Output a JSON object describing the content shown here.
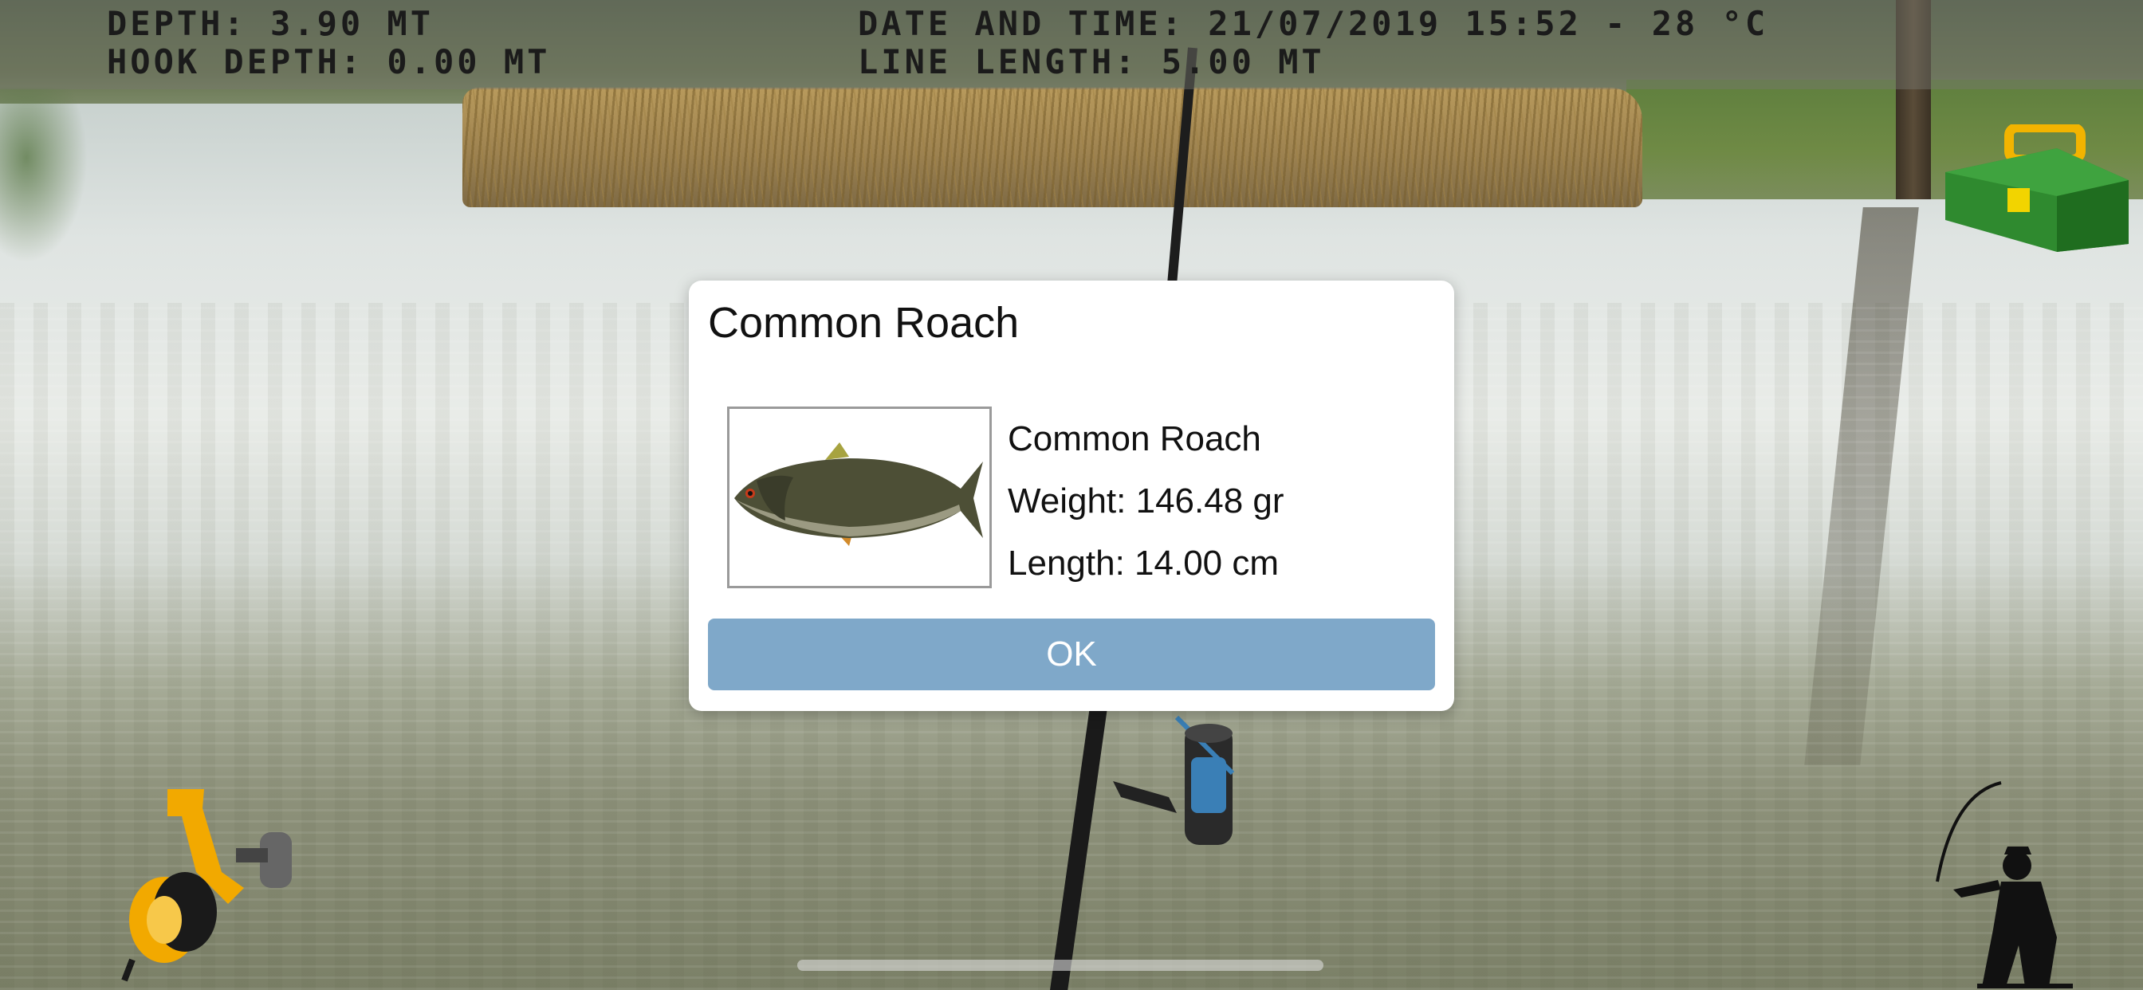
{
  "hud": {
    "depth": "DEPTH: 3.90 MT",
    "hook_depth": "HOOK DEPTH: 0.00 MT",
    "date_time": "DATE AND TIME: 21/07/2019 15:52 - 28 °C",
    "line_length": "LINE LENGTH: 5.00 MT"
  },
  "dialog": {
    "title": "Common Roach",
    "fish_name": "Common Roach",
    "weight": "Weight: 146.48 gr",
    "length": "Length: 14.00 cm",
    "ok_label": "OK"
  },
  "icons": {
    "tackle_box": "tackle-box-icon",
    "reel": "spinning-reel-icon",
    "fisherman": "fisherman-icon",
    "fish": "roach-fish-image"
  },
  "colors": {
    "ok_button": "#7fa8c9",
    "tackle_box": "#2f8a2f",
    "reel": "#f2a900"
  }
}
